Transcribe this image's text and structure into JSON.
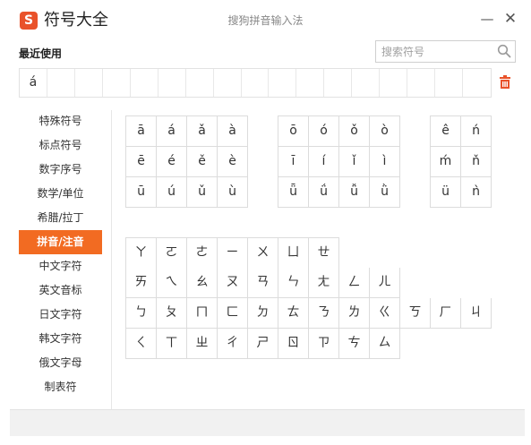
{
  "app": {
    "logo_letter": "S",
    "title": "符号大全",
    "window_title": "搜狗拼音输入法",
    "minimize_label": "—",
    "close_label": "✕"
  },
  "search": {
    "placeholder": "搜索符号",
    "icon": "search-icon"
  },
  "recent": {
    "label": "最近使用",
    "symbols": [
      "á",
      "",
      "",
      "",
      "",
      "",
      "",
      "",
      "",
      "",
      "",
      "",
      "",
      "",
      "",
      "",
      ""
    ],
    "clear_icon": "trash-icon"
  },
  "sidebar": {
    "items": [
      {
        "label": "特殊符号"
      },
      {
        "label": "标点符号"
      },
      {
        "label": "数字序号"
      },
      {
        "label": "数学/单位"
      },
      {
        "label": "希腊/拉丁"
      },
      {
        "label": "拼音/注音"
      },
      {
        "label": "中文字符"
      },
      {
        "label": "英文音标"
      },
      {
        "label": "日文字符"
      },
      {
        "label": "韩文字符"
      },
      {
        "label": "俄文字母"
      },
      {
        "label": "制表符"
      }
    ],
    "active_index": 5
  },
  "pinyin": {
    "group1": [
      "ā",
      "á",
      "ǎ",
      "à",
      "ē",
      "é",
      "ě",
      "è",
      "ū",
      "ú",
      "ǔ",
      "ù"
    ],
    "group2": [
      "ō",
      "ó",
      "ǒ",
      "ò",
      "ī",
      "í",
      "ǐ",
      "ì",
      "ǖ",
      "ǘ",
      "ǚ",
      "ǜ"
    ],
    "group3": [
      "ê",
      "ń",
      "ḿ",
      "ň",
      "ü",
      "ǹ"
    ]
  },
  "bopomofo": {
    "rows": [
      [
        "ㄚ",
        "ㄛ",
        "ㄜ",
        "ㄧ",
        "ㄨ",
        "ㄩ",
        "ㄝ"
      ],
      [
        "ㄞ",
        "ㄟ",
        "ㄠ",
        "ㄡ",
        "ㄢ",
        "ㄣ",
        "ㄤ",
        "ㄥ",
        "ㄦ"
      ],
      [
        "ㄅ",
        "ㄆ",
        "ㄇ",
        "ㄈ",
        "ㄉ",
        "ㄊ",
        "ㄋ",
        "ㄌ",
        "ㄍ",
        "ㄎ",
        "ㄏ",
        "ㄐ"
      ],
      [
        "ㄑ",
        "ㄒ",
        "ㄓ",
        "ㄔ",
        "ㄕ",
        "ㄖ",
        "ㄗ",
        "ㄘ",
        "ㄙ"
      ]
    ]
  },
  "colors": {
    "accent": "#f26b22",
    "logo": "#e9522a",
    "trash": "#e9522a"
  }
}
